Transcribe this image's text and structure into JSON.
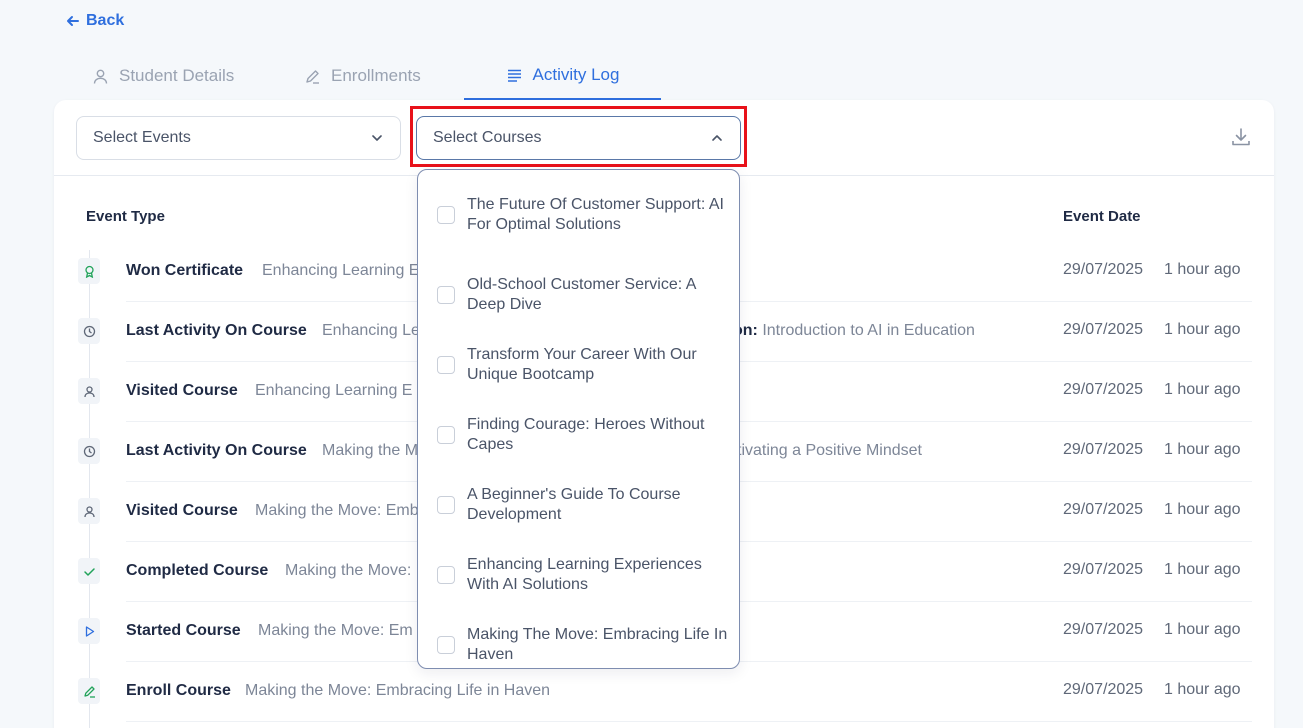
{
  "back": {
    "label": "Back"
  },
  "tabs": [
    {
      "label": "Student Details",
      "icon": "user-icon"
    },
    {
      "label": "Enrollments",
      "icon": "pencil-icon"
    },
    {
      "label": "Activity Log",
      "icon": "list-icon"
    }
  ],
  "filters": {
    "events_label": "Select Events",
    "courses_label": "Select Courses"
  },
  "table": {
    "col_type": "Event Type",
    "col_date": "Event Date",
    "rows": [
      {
        "event": "Won Certificate",
        "course": "Enhancing Learning E",
        "extra_label": "",
        "extra_value": "",
        "date": "29/07/2025",
        "ago": "1 hour ago",
        "icon": "award-icon"
      },
      {
        "event": "Last Activity On Course",
        "course": "Enhancing Le",
        "extra_label": "on:",
        "extra_value": "Introduction to AI in Education",
        "date": "29/07/2025",
        "ago": "1 hour ago",
        "icon": "clock-icon"
      },
      {
        "event": "Visited Course",
        "course": "Enhancing Learning E",
        "extra_label": "",
        "extra_value": "",
        "date": "29/07/2025",
        "ago": "1 hour ago",
        "icon": "user-icon"
      },
      {
        "event": "Last Activity On Course",
        "course": "Making the M",
        "extra_label": "",
        "extra_value": "tivating a Positive Mindset",
        "date": "29/07/2025",
        "ago": "1 hour ago",
        "icon": "clock-icon"
      },
      {
        "event": "Visited Course",
        "course": "Making the Move: Emb",
        "extra_label": "",
        "extra_value": "",
        "date": "29/07/2025",
        "ago": "1 hour ago",
        "icon": "user-icon"
      },
      {
        "event": "Completed Course",
        "course": "Making the Move:",
        "extra_label": "",
        "extra_value": "",
        "date": "29/07/2025",
        "ago": "1 hour ago",
        "icon": "check-icon"
      },
      {
        "event": "Started Course",
        "course": "Making the Move: Em",
        "extra_label": "",
        "extra_value": "",
        "date": "29/07/2025",
        "ago": "1 hour ago",
        "icon": "play-icon"
      },
      {
        "event": "Enroll Course",
        "course": "Making the Move: Embracing Life in Haven",
        "extra_label": "",
        "extra_value": "",
        "date": "29/07/2025",
        "ago": "1 hour ago",
        "icon": "pencil-icon"
      }
    ]
  },
  "dropdown": {
    "options": [
      "The Future Of Customer Support: AI For Optimal Solutions",
      "Old-School Customer Service: A Deep Dive",
      "Transform Your Career With Our Unique Bootcamp",
      "Finding Courage: Heroes Without Capes",
      "A Beginner's Guide To Course Development",
      "Enhancing Learning Experiences With AI Solutions",
      "Making The Move: Embracing Life In Haven"
    ]
  },
  "colors": {
    "accent": "#2f6fde",
    "highlight": "#e8121a",
    "success": "#22a35a"
  }
}
